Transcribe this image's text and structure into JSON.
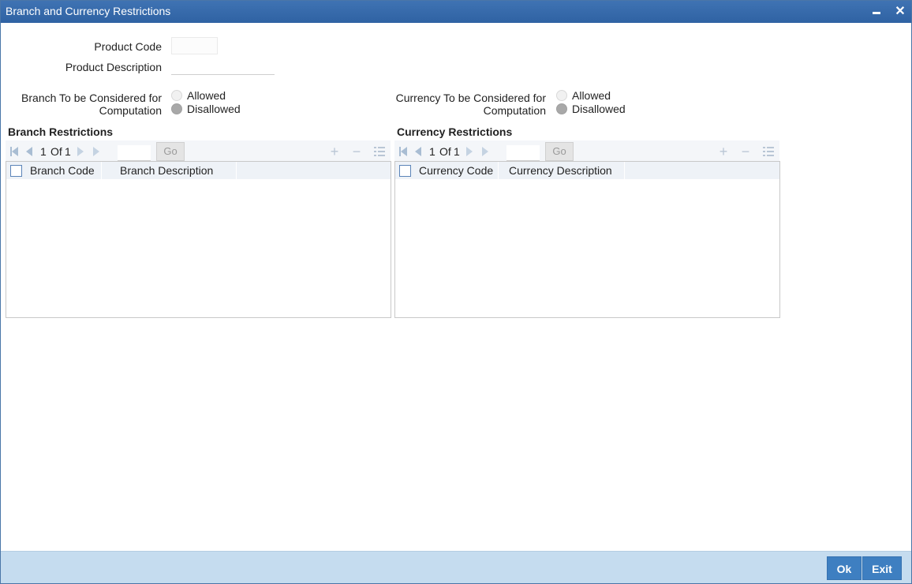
{
  "window": {
    "title": "Branch and Currency Restrictions"
  },
  "form": {
    "product_code_label": "Product Code",
    "product_code_value": "",
    "product_description_label": "Product Description",
    "product_description_value": ""
  },
  "branch_computation": {
    "label_line1": "Branch To be Considered for",
    "label_line2": "Computation",
    "options": [
      {
        "label": "Allowed",
        "checked": false
      },
      {
        "label": "Disallowed",
        "checked": true
      }
    ]
  },
  "currency_computation": {
    "label_line1": "Currency To be Considered for",
    "label_line2": "Computation",
    "options": [
      {
        "label": "Allowed",
        "checked": false
      },
      {
        "label": "Disallowed",
        "checked": true
      }
    ]
  },
  "branch_restrictions": {
    "title": "Branch Restrictions",
    "pager": {
      "current": "1",
      "of_label": "Of",
      "total": "1",
      "go_label": "Go"
    },
    "columns": [
      "Branch Code",
      "Branch Description"
    ],
    "rows": []
  },
  "currency_restrictions": {
    "title": "Currency Restrictions",
    "pager": {
      "current": "1",
      "of_label": "Of",
      "total": "1",
      "go_label": "Go"
    },
    "columns": [
      "Currency Code",
      "Currency Description"
    ],
    "rows": []
  },
  "footer": {
    "ok_label": "Ok",
    "exit_label": "Exit"
  }
}
